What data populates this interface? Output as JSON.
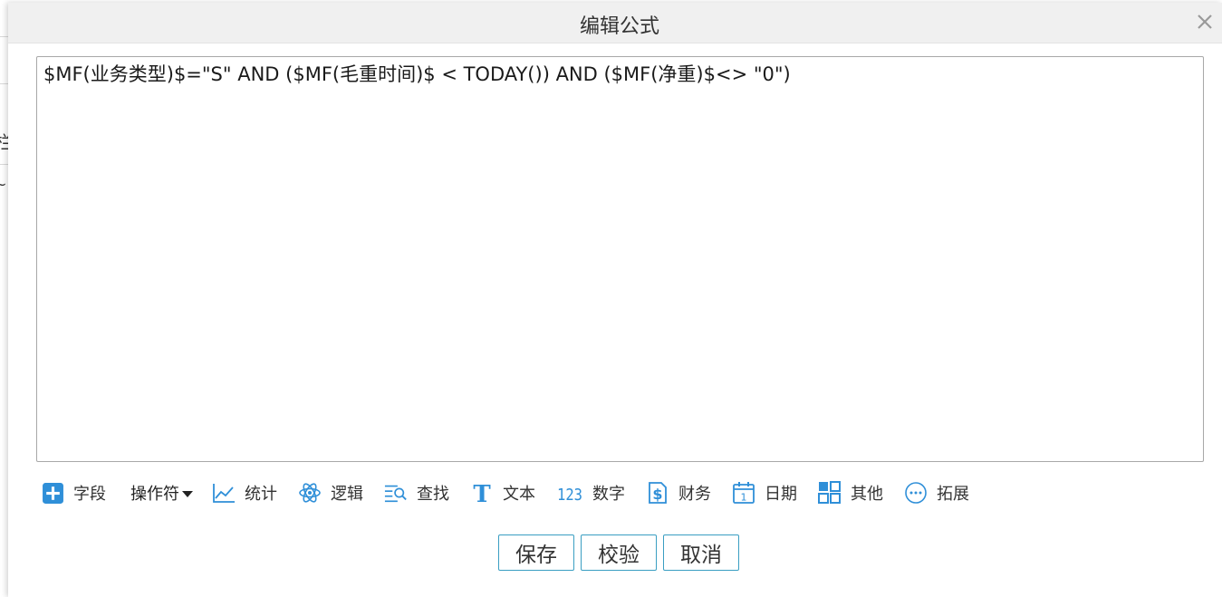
{
  "dialog": {
    "title": "编辑公式",
    "close_icon": "close-icon"
  },
  "editor": {
    "value": "$MF(业务类型)$=\"S\" AND ($MF(毛重时间)$ < TODAY()) AND ($MF(净重)$<> \"0\")"
  },
  "background": {
    "fragment_1": "栏",
    "fragment_2": "~"
  },
  "toolbar": {
    "items": [
      {
        "label": "字段",
        "icon": "plus-square-icon"
      },
      {
        "label": "操作符",
        "icon": "dropdown-caret-icon"
      },
      {
        "label": "统计",
        "icon": "line-chart-icon"
      },
      {
        "label": "逻辑",
        "icon": "atom-icon"
      },
      {
        "label": "查找",
        "icon": "search-list-icon"
      },
      {
        "label": "文本",
        "icon": "text-t-icon"
      },
      {
        "label": "数字",
        "icon": "number-123-icon"
      },
      {
        "label": "财务",
        "icon": "dollar-icon"
      },
      {
        "label": "日期",
        "icon": "calendar-icon"
      },
      {
        "label": "其他",
        "icon": "grid-icon"
      },
      {
        "label": "拓展",
        "icon": "more-circle-icon"
      }
    ]
  },
  "buttons": {
    "save": "保存",
    "validate": "校验",
    "cancel": "取消"
  },
  "colors": {
    "accent": "#3a9ec2",
    "icon_blue": "#2f8fd8",
    "title_bar": "#f0f0f0"
  }
}
